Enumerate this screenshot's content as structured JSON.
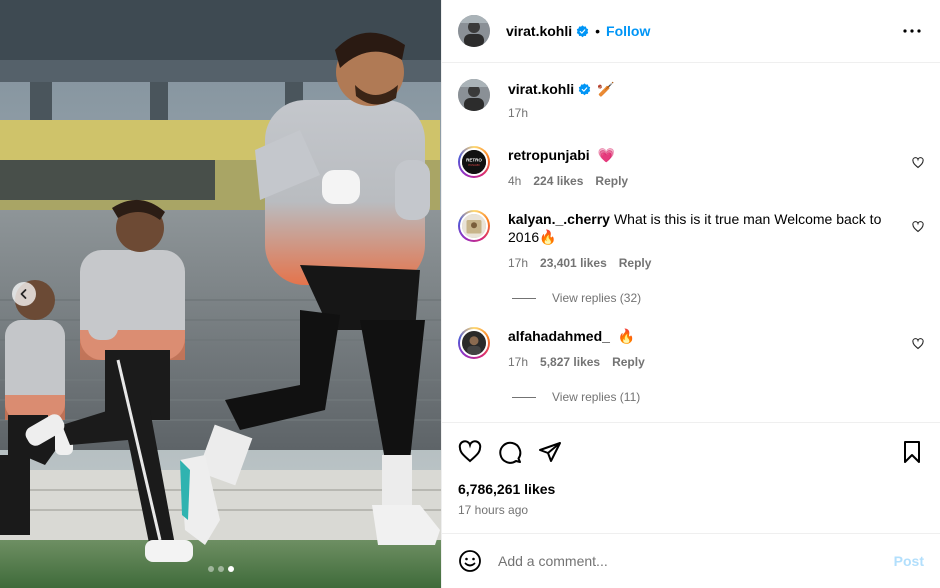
{
  "post": {
    "author": "virat.kohli",
    "follow_label": "Follow",
    "separator": "•",
    "carousel": {
      "slides": 3,
      "active_index": 2
    }
  },
  "caption": {
    "username": "virat.kohli",
    "text": "🏏",
    "time": "17h"
  },
  "comments": [
    {
      "username": "retropunjabi",
      "text": "💗",
      "time": "4h",
      "likes": "224 likes",
      "reply_label": "Reply",
      "avatar_text": "RETRO PUNJABI"
    },
    {
      "username": "kalyan._.cherry",
      "text": "What is this is it true man Welcome back to 2016🔥",
      "time": "17h",
      "likes": "23,401 likes",
      "reply_label": "Reply",
      "view_replies": "View replies (32)"
    },
    {
      "username": "alfahadahmed_",
      "text": "🔥",
      "time": "17h",
      "likes": "5,827 likes",
      "reply_label": "Reply",
      "view_replies": "View replies (11)"
    }
  ],
  "likes_count": "6,786,261 likes",
  "posted_ago": "17 hours ago",
  "comment_box": {
    "placeholder": "Add a comment...",
    "post_label": "Post"
  },
  "colors": {
    "accent": "#0095f6",
    "post_disabled": "#b2dffc",
    "muted": "#737373"
  },
  "icons": [
    "more-icon",
    "verified-icon",
    "heart-icon",
    "comment-icon",
    "share-icon",
    "bookmark-icon",
    "emoji-icon",
    "chevron-left-icon"
  ]
}
